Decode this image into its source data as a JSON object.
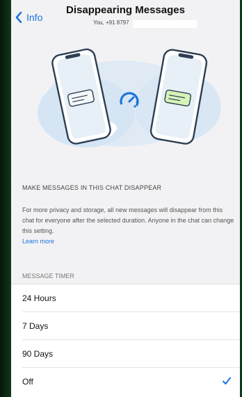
{
  "nav": {
    "back_label": "Info",
    "title": "Disappearing Messages",
    "subtitle": "You, +91 8797"
  },
  "section": {
    "header": "MAKE MESSAGES IN THIS CHAT DISAPPEAR",
    "description": "For more privacy and storage, all new messages will disappear from this chat for everyone after the selected duration. Anyone in the chat can change this setting.",
    "learn_more": "Learn more"
  },
  "timer": {
    "header": "MESSAGE TIMER",
    "options": [
      {
        "label": "24 Hours",
        "selected": false
      },
      {
        "label": "7 Days",
        "selected": false
      },
      {
        "label": "90 Days",
        "selected": false
      },
      {
        "label": "Off",
        "selected": true
      }
    ]
  },
  "colors": {
    "accent": "#1b74de",
    "background": "#f2f2f4",
    "phone_fill": "#dbe9f6",
    "bubble_left": "#e9eef3",
    "bubble_right": "#d6f3b8",
    "cloud": "#ffffff"
  },
  "icons": {
    "back": "chevron-left-icon",
    "timer": "timer-icon",
    "check": "checkmark-icon"
  }
}
